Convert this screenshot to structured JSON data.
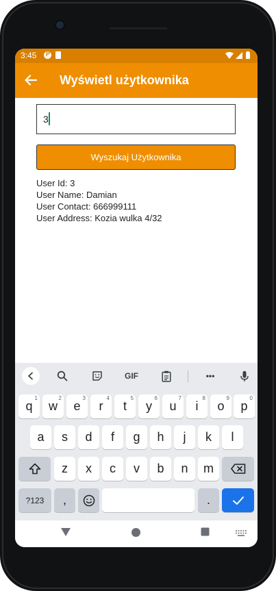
{
  "status_bar": {
    "time": "3:45"
  },
  "app_bar": {
    "title": "Wyświetl użytkownika"
  },
  "search": {
    "value": "3"
  },
  "search_button": {
    "label": "Wyszukaj Użytkownika"
  },
  "user_info": {
    "id_line": "User Id: 3",
    "name_line": "User Name: Damian",
    "contact_line": "User Contact: 666999111",
    "address_line": "User Address: Kozia wulka 4/32"
  },
  "keyboard": {
    "toolbar": {
      "gif_label": "GIF",
      "more_label": "•••"
    },
    "row1": [
      {
        "k": "q",
        "s": "1"
      },
      {
        "k": "w",
        "s": "2"
      },
      {
        "k": "e",
        "s": "3"
      },
      {
        "k": "r",
        "s": "4"
      },
      {
        "k": "t",
        "s": "5"
      },
      {
        "k": "y",
        "s": "6"
      },
      {
        "k": "u",
        "s": "7"
      },
      {
        "k": "i",
        "s": "8"
      },
      {
        "k": "o",
        "s": "9"
      },
      {
        "k": "p",
        "s": "0"
      }
    ],
    "row2": [
      "a",
      "s",
      "d",
      "f",
      "g",
      "h",
      "j",
      "k",
      "l"
    ],
    "row3": [
      "z",
      "x",
      "c",
      "v",
      "b",
      "n",
      "m"
    ],
    "symbols_label": "?123",
    "comma_label": ",",
    "period_label": "."
  },
  "colors": {
    "accent": "#ef8e00",
    "status_bar": "#d97f00",
    "keyboard_bg": "#e8eaed",
    "enter_key": "#1a73e8",
    "caret": "#128a72"
  }
}
